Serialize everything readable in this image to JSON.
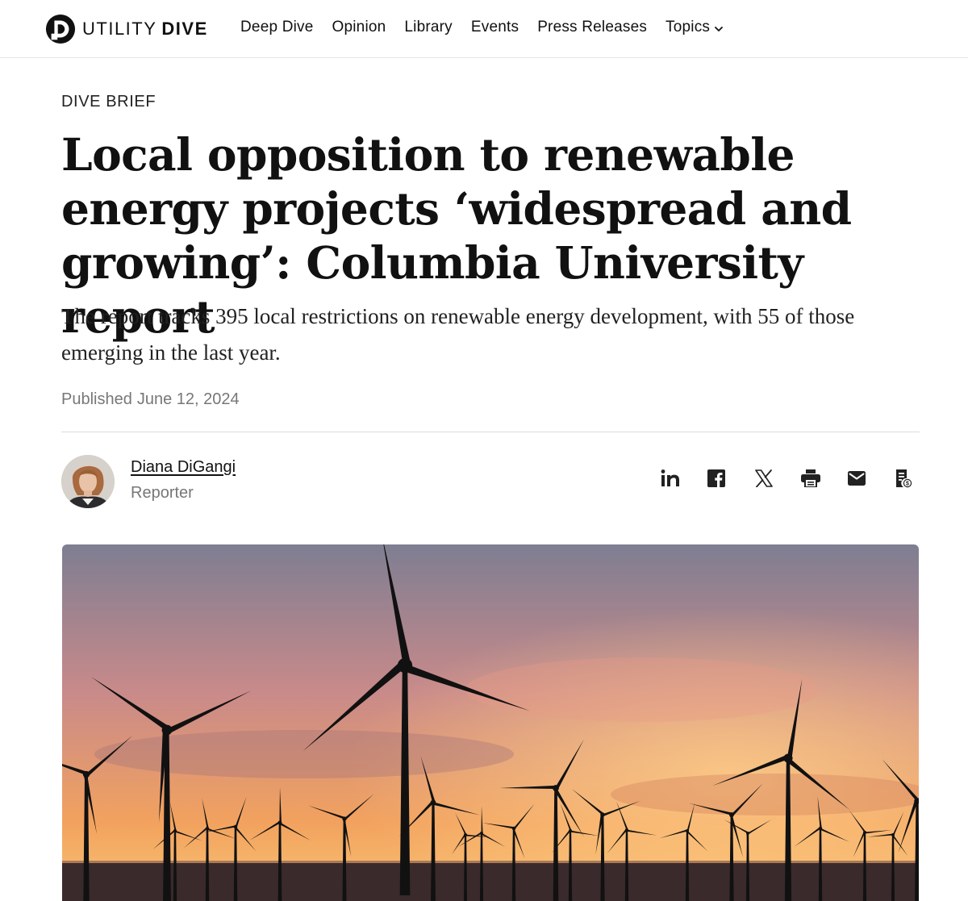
{
  "site": {
    "logo_word1": "UTILITY",
    "logo_word2": "DIVE",
    "logo_icon": "utility-dive-logo-icon"
  },
  "nav": {
    "items": [
      {
        "label": "Deep Dive"
      },
      {
        "label": "Opinion"
      },
      {
        "label": "Library"
      },
      {
        "label": "Events"
      },
      {
        "label": "Press Releases"
      },
      {
        "label": "Topics",
        "icon": "chevron-down-icon"
      }
    ]
  },
  "article": {
    "kicker": "DIVE BRIEF",
    "headline": "Local opposition to renewable energy projects ‘widespread and growing’: Columbia University report",
    "dek": "The report tracks 395 local restrictions on renewable energy development, with 55 of those emerging in the last year.",
    "published_label": "Published",
    "published_date": "June 12, 2024"
  },
  "author": {
    "name": "Diana DiGangi",
    "role": "Reporter"
  },
  "share": {
    "icons": [
      "linkedin-icon",
      "facebook-icon",
      "x-icon",
      "print-icon",
      "email-icon",
      "license-icon"
    ],
    "linkedin_text": "in"
  },
  "hero": {
    "description_icon": "wind-turbines-sunset-image",
    "colors": {
      "sky_top": "#7e7e92",
      "sky_mid": "#c98a8a",
      "sunset": "#f2a25e",
      "horizon": "#f6b46a",
      "sea": "#3a2a2c"
    }
  },
  "colors": {
    "text": "#111111",
    "muted": "#777777",
    "divider": "#dcdcdc"
  }
}
